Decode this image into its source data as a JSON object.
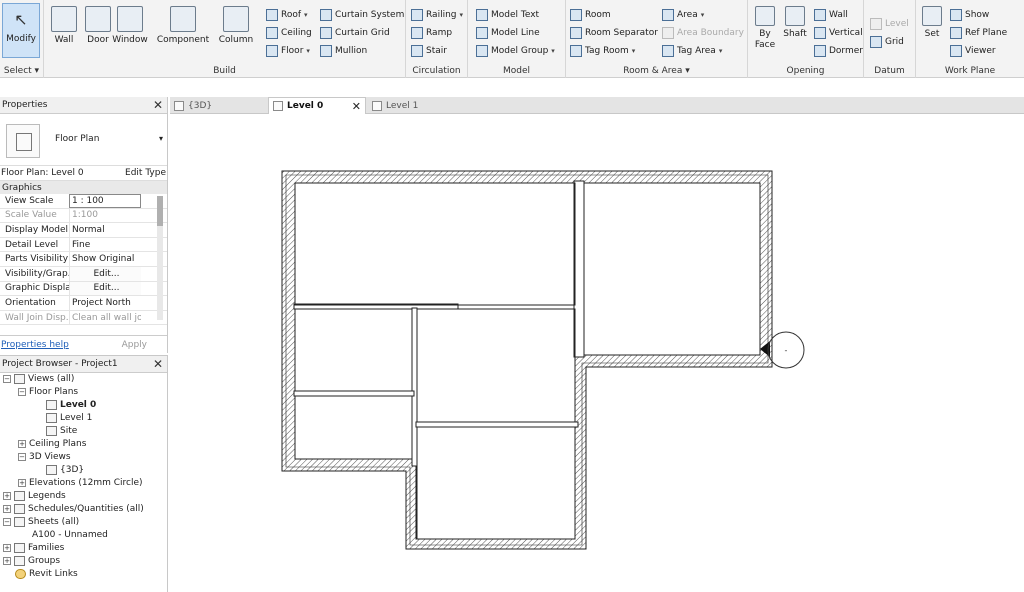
{
  "ribbon": {
    "modify": {
      "label": "Modify",
      "select": "Select ▾"
    },
    "build": {
      "label": "Build",
      "big": [
        "Wall",
        "Door",
        "Window",
        "Component",
        "Column"
      ],
      "small": [
        "Roof",
        "Ceiling",
        "Floor",
        "Curtain System",
        "Curtain Grid",
        "Mullion"
      ]
    },
    "circulation": {
      "label": "Circulation",
      "items": [
        "Railing",
        "Ramp",
        "Stair"
      ]
    },
    "model": {
      "label": "Model",
      "items": [
        "Model Text",
        "Model Line",
        "Model Group"
      ]
    },
    "room_area": {
      "label": "Room & Area ▾",
      "items": [
        "Room",
        "Room Separator",
        "Tag Room",
        "Area",
        "Area Boundary",
        "Tag Area"
      ]
    },
    "opening": {
      "label": "Opening",
      "by_face": "By Face",
      "shaft": "Shaft",
      "items": [
        "Wall",
        "Vertical",
        "Dormer"
      ]
    },
    "datum": {
      "label": "Datum",
      "items": [
        "Level",
        "Grid"
      ]
    },
    "work_plane": {
      "label": "Work Plane",
      "set": "Set",
      "items": [
        "Show",
        "Ref Plane",
        "Viewer"
      ]
    }
  },
  "tabs": [
    {
      "label": "{3D}",
      "active": false
    },
    {
      "label": "Level 0",
      "active": true
    },
    {
      "label": "Level 1",
      "active": false
    }
  ],
  "properties": {
    "title": "Properties",
    "type_name": "Floor Plan",
    "instance": "Floor Plan: Level 0",
    "edit_type": "Edit Type",
    "category": "Graphics",
    "rows": [
      {
        "key": "View Scale",
        "value": "1 : 100"
      },
      {
        "key": "Scale Value",
        "value": "1:100"
      },
      {
        "key": "Display Model",
        "value": "Normal"
      },
      {
        "key": "Detail Level",
        "value": "Fine"
      },
      {
        "key": "Parts Visibility",
        "value": "Show Original"
      },
      {
        "key": "Visibility/Grap...",
        "value": "Edit..."
      },
      {
        "key": "Graphic Displa...",
        "value": "Edit..."
      },
      {
        "key": "Orientation",
        "value": "Project North"
      },
      {
        "key": "Wall Join Disp...",
        "value": "Clean all wall jo..."
      }
    ],
    "help": "Properties help",
    "apply": "Apply"
  },
  "browser": {
    "title": "Project Browser - Project1",
    "nodes": [
      {
        "label": "Views (all)",
        "toggle": "−"
      },
      {
        "label": "Floor Plans",
        "toggle": "−"
      },
      {
        "label": "Level 0",
        "toggle": ""
      },
      {
        "label": "Level 1",
        "toggle": ""
      },
      {
        "label": "Site",
        "toggle": ""
      },
      {
        "label": "Ceiling Plans",
        "toggle": "+"
      },
      {
        "label": "3D Views",
        "toggle": "−"
      },
      {
        "label": "{3D}",
        "toggle": ""
      },
      {
        "label": "Elevations (12mm Circle)",
        "toggle": "+"
      },
      {
        "label": "Legends",
        "toggle": "+"
      },
      {
        "label": "Schedules/Quantities (all)",
        "toggle": "+"
      },
      {
        "label": "Sheets (all)",
        "toggle": "−"
      },
      {
        "label": "A100 - Unnamed",
        "toggle": ""
      },
      {
        "label": "Families",
        "toggle": "+"
      },
      {
        "label": "Groups",
        "toggle": "+"
      },
      {
        "label": "Revit Links",
        "toggle": ""
      }
    ]
  },
  "canvas": {
    "cursor_label": "-"
  }
}
